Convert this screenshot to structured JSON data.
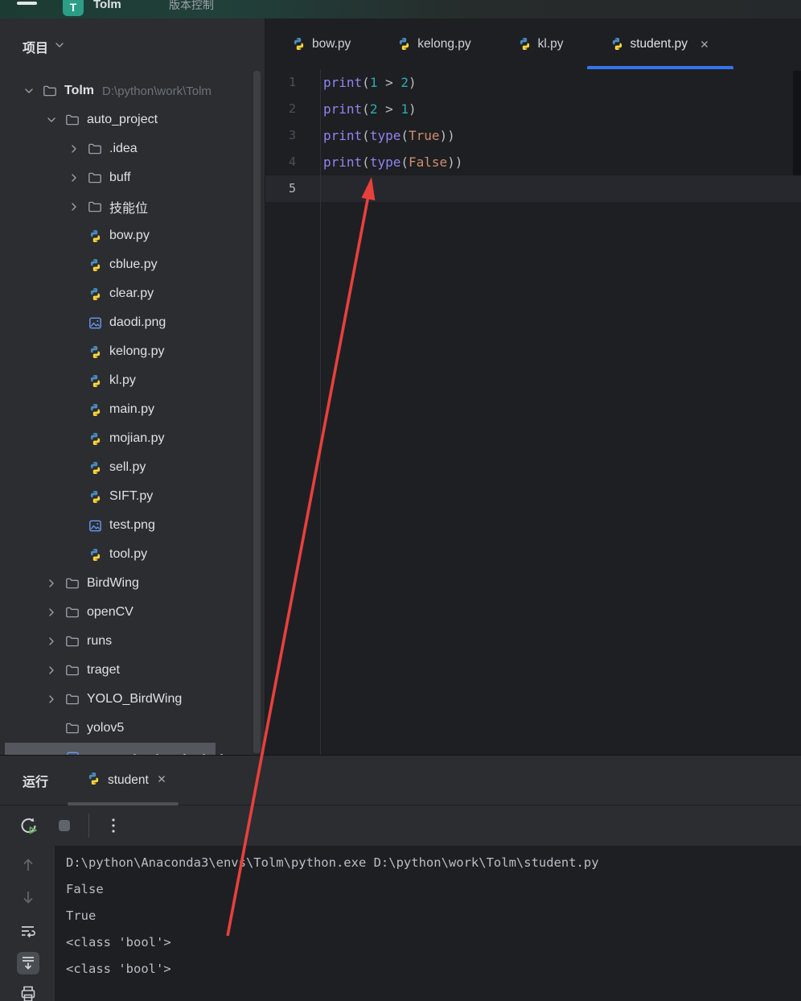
{
  "title_bar": {
    "app_initial": "T",
    "project_name": "Tolm",
    "vcs_label": "版本控制"
  },
  "project_panel": {
    "header": "项目",
    "items": [
      {
        "label": "Tolm",
        "suffix": "D:\\python\\work\\Tolm",
        "icon": "folder",
        "chevron": "down",
        "level": 0,
        "bold": true
      },
      {
        "label": "auto_project",
        "icon": "folder",
        "chevron": "down",
        "level": 1
      },
      {
        "label": ".idea",
        "icon": "folder",
        "chevron": "right",
        "level": 2
      },
      {
        "label": "buff",
        "icon": "folder",
        "chevron": "right",
        "level": 2
      },
      {
        "label": "技能位",
        "icon": "folder",
        "chevron": "right",
        "level": 2
      },
      {
        "label": "bow.py",
        "icon": "python",
        "chevron": "none",
        "level": 2
      },
      {
        "label": "cblue.py",
        "icon": "python",
        "chevron": "none",
        "level": 2
      },
      {
        "label": "clear.py",
        "icon": "python",
        "chevron": "none",
        "level": 2
      },
      {
        "label": "daodi.png",
        "icon": "image",
        "chevron": "none",
        "level": 2
      },
      {
        "label": "kelong.py",
        "icon": "python",
        "chevron": "none",
        "level": 2
      },
      {
        "label": "kl.py",
        "icon": "python",
        "chevron": "none",
        "level": 2
      },
      {
        "label": "main.py",
        "icon": "python",
        "chevron": "none",
        "level": 2
      },
      {
        "label": "mojian.py",
        "icon": "python",
        "chevron": "none",
        "level": 2
      },
      {
        "label": "sell.py",
        "icon": "python",
        "chevron": "none",
        "level": 2
      },
      {
        "label": "SIFT.py",
        "icon": "python",
        "chevron": "none",
        "level": 2
      },
      {
        "label": "test.png",
        "icon": "image",
        "chevron": "none",
        "level": 2
      },
      {
        "label": "tool.py",
        "icon": "python",
        "chevron": "none",
        "level": 2
      },
      {
        "label": "BirdWing",
        "icon": "folder",
        "chevron": "right",
        "level": 1
      },
      {
        "label": "openCV",
        "icon": "folder",
        "chevron": "right",
        "level": 1
      },
      {
        "label": "runs",
        "icon": "folder",
        "chevron": "right",
        "level": 1
      },
      {
        "label": "traget",
        "icon": "folder",
        "chevron": "right",
        "level": 1
      },
      {
        "label": "YOLO_BirdWing",
        "icon": "folder",
        "chevron": "right",
        "level": 1
      },
      {
        "label": "yolov5",
        "icon": "folder",
        "chevron": "none",
        "level": 1
      },
      {
        "label": "",
        "icon": "image",
        "chevron": "none",
        "level": 1,
        "selected": true,
        "cut": true
      }
    ]
  },
  "editor": {
    "tabs": [
      {
        "label": "bow.py",
        "active": false,
        "closable": false
      },
      {
        "label": "kelong.py",
        "active": false,
        "closable": false
      },
      {
        "label": "kl.py",
        "active": false,
        "closable": false
      },
      {
        "label": "student.py",
        "active": true,
        "closable": true
      }
    ],
    "code_lines": [
      {
        "num": "1",
        "current": false,
        "tokens": [
          [
            "print",
            "func"
          ],
          [
            "(",
            "plain"
          ],
          [
            "1",
            "num"
          ],
          [
            " > ",
            "plain"
          ],
          [
            "2",
            "num"
          ],
          [
            ")",
            "plain"
          ]
        ]
      },
      {
        "num": "2",
        "current": false,
        "tokens": [
          [
            "print",
            "func"
          ],
          [
            "(",
            "plain"
          ],
          [
            "2",
            "num"
          ],
          [
            " > ",
            "plain"
          ],
          [
            "1",
            "num"
          ],
          [
            ")",
            "plain"
          ]
        ]
      },
      {
        "num": "3",
        "current": false,
        "tokens": [
          [
            "print",
            "func"
          ],
          [
            "(",
            "plain"
          ],
          [
            "type",
            "func"
          ],
          [
            "(",
            "plain"
          ],
          [
            "True",
            "kw"
          ],
          [
            "))",
            "plain"
          ]
        ]
      },
      {
        "num": "4",
        "current": false,
        "tokens": [
          [
            "print",
            "func"
          ],
          [
            "(",
            "plain"
          ],
          [
            "type",
            "func"
          ],
          [
            "(",
            "plain"
          ],
          [
            "False",
            "kw"
          ],
          [
            "))",
            "plain"
          ]
        ]
      },
      {
        "num": "5",
        "current": true,
        "tokens": []
      }
    ]
  },
  "run_panel": {
    "header": "运行",
    "tab": {
      "label": "student",
      "closable": true
    },
    "toolbar_icons": [
      "rerun-icon",
      "stop-icon",
      "separator",
      "more-options-icon"
    ],
    "gutter_icons": [
      "scroll-up-icon",
      "scroll-down-icon",
      "soft-wrap-icon",
      "scroll-to-end-icon",
      "print-icon"
    ],
    "console_lines": [
      "D:\\python\\Anaconda3\\envs\\Tolm\\python.exe D:\\python\\work\\Tolm\\student.py",
      "False",
      "True",
      "<class 'bool'>",
      "<class 'bool'>"
    ]
  },
  "annotation": {
    "arrow_color": "#E8403C"
  },
  "colors": {
    "accent_blue": "#3574F0",
    "titlebar_teal": "#2C9E86",
    "panel_bg": "#2B2D30",
    "editor_bg": "#1E1F22",
    "token_function": "#8F85F0",
    "token_number": "#2AACB8",
    "token_keyword": "#CF8E6D",
    "token_plain": "#BCBEC4",
    "python_blue": "#4B8BBE",
    "python_yellow": "#FFD43B"
  }
}
